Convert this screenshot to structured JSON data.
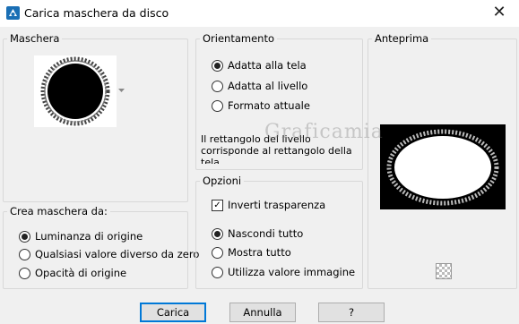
{
  "window": {
    "title": "Carica maschera da disco",
    "close_glyph": "✕",
    "icon": "app-mask-icon"
  },
  "maschera": {
    "legend": "Maschera"
  },
  "orientamento": {
    "legend": "Orientamento",
    "options": [
      "Adatta alla tela",
      "Adatta al livello",
      "Formato attuale"
    ],
    "selected": "Adatta alla tela",
    "description": "Il rettangolo del livello corrisponde al rettangolo della tela."
  },
  "opzioni": {
    "legend": "Opzioni",
    "invert_label": "Inverti trasparenza",
    "invert_checked": true,
    "options": [
      "Nascondi tutto",
      "Mostra tutto",
      "Utilizza valore immagine"
    ],
    "selected": "Nascondi tutto"
  },
  "crea": {
    "legend": "Crea maschera da:",
    "options": [
      "Luminanza di origine",
      "Qualsiasi valore diverso da zero",
      "Opacità di origine"
    ],
    "selected": "Luminanza di origine"
  },
  "anteprima": {
    "legend": "Anteprima",
    "zoom_icon": "checker-zoom-icon"
  },
  "buttons": {
    "ok": "Carica",
    "cancel": "Annulla",
    "help": "?"
  },
  "watermark": "Graficamia"
}
